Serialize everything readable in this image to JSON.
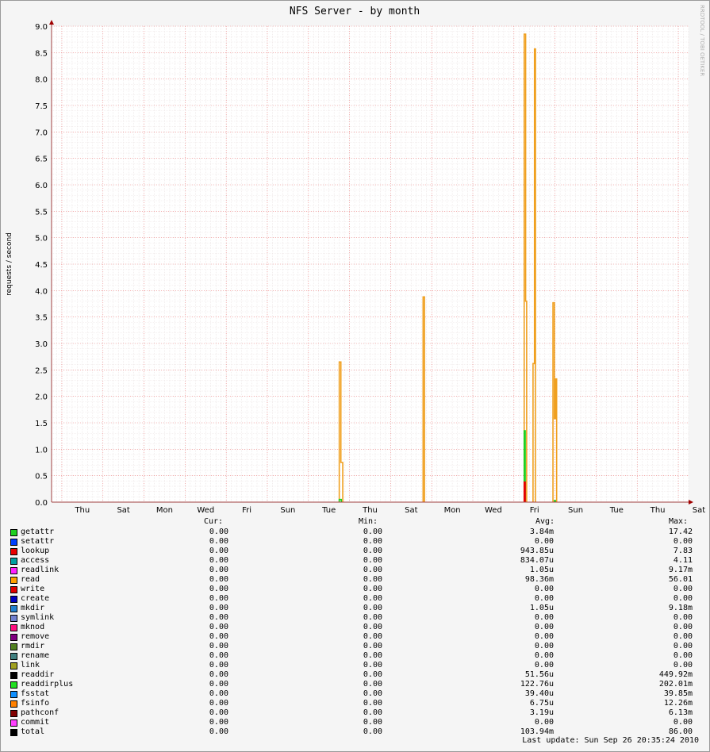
{
  "chart_data": {
    "type": "area",
    "title": "NFS Server - by month",
    "ylabel": "requests / second",
    "watermark": "RRDTOOL / TOBI OETIKER",
    "ylim": [
      0,
      9.0
    ],
    "yticks": [
      "0.0",
      "0.5",
      "1.0",
      "1.5",
      "2.0",
      "2.5",
      "3.0",
      "3.5",
      "4.0",
      "4.5",
      "5.0",
      "5.5",
      "6.0",
      "6.5",
      "7.0",
      "7.5",
      "8.0",
      "8.5",
      "9.0"
    ],
    "xtick_labels": [
      "Thu",
      "Sat",
      "Mon",
      "Wed",
      "Fri",
      "Sun",
      "Tue",
      "Thu",
      "Sat",
      "Mon",
      "Wed",
      "Fri",
      "Sun",
      "Tue",
      "Thu",
      "Sat"
    ],
    "grid": true,
    "series": [
      {
        "name": "read",
        "color": "#f0a020",
        "spikes": [
          {
            "day": 14.0,
            "points": [
              [
                14.0,
                0
              ],
              [
                14.0,
                2.65
              ],
              [
                14.08,
                2.65
              ],
              [
                14.08,
                0.75
              ],
              [
                14.17,
                0.75
              ],
              [
                14.17,
                0
              ]
            ]
          },
          {
            "day": 18.1,
            "points": [
              [
                18.08,
                0
              ],
              [
                18.08,
                3.88
              ],
              [
                18.15,
                3.88
              ],
              [
                18.15,
                0
              ]
            ]
          },
          {
            "day": 23.0,
            "points": [
              [
                23.0,
                0
              ],
              [
                23.0,
                8.85
              ],
              [
                23.07,
                8.85
              ],
              [
                23.07,
                3.8
              ],
              [
                23.12,
                3.8
              ],
              [
                23.12,
                0
              ]
            ]
          },
          {
            "day": 23.5,
            "points": [
              [
                23.43,
                0
              ],
              [
                23.43,
                2.62
              ],
              [
                23.5,
                2.62
              ],
              [
                23.5,
                8.57
              ],
              [
                23.55,
                8.57
              ],
              [
                23.55,
                0
              ]
            ]
          },
          {
            "day": 24.5,
            "points": [
              [
                24.4,
                0
              ],
              [
                24.4,
                3.77
              ],
              [
                24.47,
                3.77
              ],
              [
                24.47,
                1.58
              ],
              [
                24.52,
                1.58
              ],
              [
                24.52,
                2.33
              ],
              [
                24.58,
                2.33
              ],
              [
                24.58,
                0
              ]
            ]
          }
        ]
      },
      {
        "name": "getattr",
        "color": "#20d020",
        "spikes": [
          {
            "day": 14.0,
            "points": [
              [
                14.0,
                0
              ],
              [
                14.0,
                0.05
              ],
              [
                14.1,
                0.05
              ],
              [
                14.1,
                0
              ]
            ]
          },
          {
            "day": 23.0,
            "points": [
              [
                23.0,
                0
              ],
              [
                23.0,
                1.35
              ],
              [
                23.05,
                1.35
              ],
              [
                23.05,
                0
              ]
            ]
          },
          {
            "day": 24.5,
            "points": [
              [
                24.47,
                0
              ],
              [
                24.47,
                0.03
              ],
              [
                24.52,
                0.03
              ],
              [
                24.52,
                0
              ]
            ]
          }
        ]
      },
      {
        "name": "lookup",
        "color": "#e80000",
        "spikes": [
          {
            "day": 23.0,
            "points": [
              [
                23.0,
                0
              ],
              [
                23.0,
                0.38
              ],
              [
                23.05,
                0.38
              ],
              [
                23.05,
                0
              ]
            ]
          }
        ]
      }
    ]
  },
  "legend": {
    "headers": {
      "cur": "Cur:",
      "min": "Min:",
      "avg": "Avg:",
      "max": "Max:"
    },
    "rows": [
      {
        "name": "getattr",
        "color": "#20d020",
        "cur": "0.00",
        "min": "0.00",
        "avg": "3.84m",
        "max": "17.42"
      },
      {
        "name": "setattr",
        "color": "#0040ff",
        "cur": "0.00",
        "min": "0.00",
        "avg": "0.00",
        "max": "0.00"
      },
      {
        "name": "lookup",
        "color": "#e80000",
        "cur": "0.00",
        "min": "0.00",
        "avg": "943.85u",
        "max": "7.83"
      },
      {
        "name": "access",
        "color": "#00a0a0",
        "cur": "0.00",
        "min": "0.00",
        "avg": "834.07u",
        "max": "4.11"
      },
      {
        "name": "readlink",
        "color": "#ff20ff",
        "cur": "0.00",
        "min": "0.00",
        "avg": "1.05u",
        "max": "9.17m"
      },
      {
        "name": "read",
        "color": "#ffa000",
        "cur": "0.00",
        "min": "0.00",
        "avg": "98.36m",
        "max": "56.01"
      },
      {
        "name": "write",
        "color": "#e00000",
        "cur": "0.00",
        "min": "0.00",
        "avg": "0.00",
        "max": "0.00"
      },
      {
        "name": "create",
        "color": "#0000c0",
        "cur": "0.00",
        "min": "0.00",
        "avg": "0.00",
        "max": "0.00"
      },
      {
        "name": "mkdir",
        "color": "#2080d0",
        "cur": "0.00",
        "min": "0.00",
        "avg": "1.05u",
        "max": "9.18m"
      },
      {
        "name": "symlink",
        "color": "#7080d0",
        "cur": "0.00",
        "min": "0.00",
        "avg": "0.00",
        "max": "0.00"
      },
      {
        "name": "mknod",
        "color": "#ff1080",
        "cur": "0.00",
        "min": "0.00",
        "avg": "0.00",
        "max": "0.00"
      },
      {
        "name": "remove",
        "color": "#800080",
        "cur": "0.00",
        "min": "0.00",
        "avg": "0.00",
        "max": "0.00"
      },
      {
        "name": "rmdir",
        "color": "#508020",
        "cur": "0.00",
        "min": "0.00",
        "avg": "0.00",
        "max": "0.00"
      },
      {
        "name": "rename",
        "color": "#408080",
        "cur": "0.00",
        "min": "0.00",
        "avg": "0.00",
        "max": "0.00"
      },
      {
        "name": "link",
        "color": "#a0a020",
        "cur": "0.00",
        "min": "0.00",
        "avg": "0.00",
        "max": "0.00"
      },
      {
        "name": "readdir",
        "color": "#000000",
        "cur": "0.00",
        "min": "0.00",
        "avg": "51.56u",
        "max": "449.92m"
      },
      {
        "name": "readdirplus",
        "color": "#20e020",
        "cur": "0.00",
        "min": "0.00",
        "avg": "122.76u",
        "max": "202.01m"
      },
      {
        "name": "fsstat",
        "color": "#1090ff",
        "cur": "0.00",
        "min": "0.00",
        "avg": "39.40u",
        "max": "39.85m"
      },
      {
        "name": "fsinfo",
        "color": "#ff8000",
        "cur": "0.00",
        "min": "0.00",
        "avg": "6.75u",
        "max": "12.26m"
      },
      {
        "name": "pathconf",
        "color": "#800000",
        "cur": "0.00",
        "min": "0.00",
        "avg": "3.19u",
        "max": "6.13m"
      },
      {
        "name": "commit",
        "color": "#ff40ff",
        "cur": "0.00",
        "min": "0.00",
        "avg": "0.00",
        "max": "0.00"
      },
      {
        "name": "total",
        "color": "#000000",
        "cur": "0.00",
        "min": "0.00",
        "avg": "103.94m",
        "max": "86.00"
      }
    ],
    "last_update": "Last update:  Sun Sep 26 20:35:24 2010"
  }
}
